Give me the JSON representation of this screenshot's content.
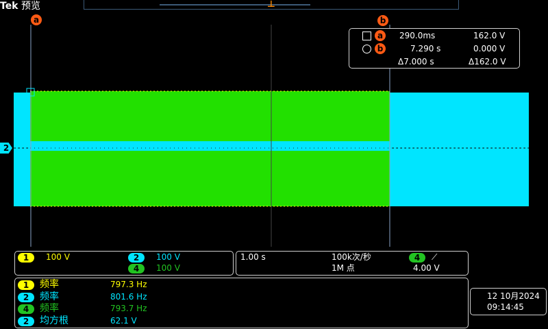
{
  "brand": {
    "name": "Tek",
    "mode": "预览"
  },
  "cursor_labels": {
    "a": "a",
    "b": "b"
  },
  "channel_marker": "2",
  "cursor_readout": {
    "a": {
      "time": "290.0ms",
      "value": "162.0 V"
    },
    "b": {
      "time": "7.290 s",
      "value": "0.000 V"
    },
    "delta": {
      "time": "Δ7.000 s",
      "value": "Δ162.0 V"
    }
  },
  "channels": [
    {
      "num": "1",
      "scale": "100 V",
      "color": "#ffff00"
    },
    {
      "num": "2",
      "scale": "100 V",
      "color": "#00e5ff"
    },
    {
      "num": "4",
      "scale": "100 V",
      "color": "#22c322"
    }
  ],
  "horizontal": {
    "timebase": "1.00 s",
    "sample_rate": "100k次/秒",
    "record_length": "1M 点",
    "trigger_source": "4",
    "trigger_slope": "⟋",
    "trigger_level": "4.00 V"
  },
  "measurements": [
    {
      "channel": "1",
      "name": "频率",
      "value": "797.3 Hz",
      "color": "#ffff00"
    },
    {
      "channel": "2",
      "name": "频率",
      "value": "801.6 Hz",
      "color": "#00e5ff"
    },
    {
      "channel": "4",
      "name": "频率",
      "value": "793.7 Hz",
      "color": "#22c322"
    },
    {
      "channel": "2",
      "name": "均方根",
      "value": "62.1 V",
      "color": "#00e5ff"
    }
  ],
  "clock": {
    "date": "12 10月2024",
    "time": "09:14:45"
  },
  "colors": {
    "ch1": "#ffff00",
    "ch2": "#00e5ff",
    "ch4": "#22c322",
    "cursor": "#ff5a14",
    "trigger": "#ff8a00"
  }
}
